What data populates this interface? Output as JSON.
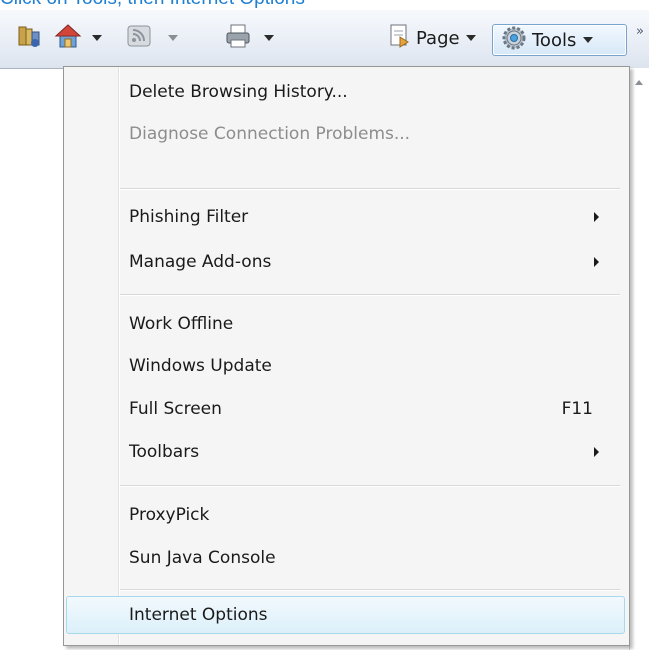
{
  "caption": "Click on Tools, then Internet Options",
  "toolbar": {
    "page_label": "Page",
    "tools_label": "Tools",
    "overflow_glyph": "»",
    "icons": [
      "feeds-reading-icon",
      "home-icon",
      "rss-feed-icon",
      "print-icon",
      "page-icon",
      "gear-icon"
    ]
  },
  "menu": {
    "items": [
      {
        "label": "Delete Browsing History...",
        "enabled": true
      },
      {
        "label": "Diagnose Connection Problems...",
        "enabled": false
      },
      {
        "label": "Phishing Filter",
        "enabled": true,
        "submenu": true
      },
      {
        "label": "Manage Add-ons",
        "enabled": true,
        "submenu": true
      },
      {
        "label": "Work Offline",
        "enabled": true
      },
      {
        "label": "Windows Update",
        "enabled": true
      },
      {
        "label": "Full Screen",
        "enabled": true,
        "shortcut": "F11"
      },
      {
        "label": "Toolbars",
        "enabled": true,
        "submenu": true
      },
      {
        "label": "ProxyPick",
        "enabled": true
      },
      {
        "label": "Sun Java Console",
        "enabled": true
      },
      {
        "label": "Internet Options",
        "enabled": true,
        "highlighted": true
      }
    ]
  },
  "colors": {
    "caption": "#1f7fd0",
    "highlight_border": "#a8d8eb",
    "menu_background": "#f5f5f5"
  }
}
